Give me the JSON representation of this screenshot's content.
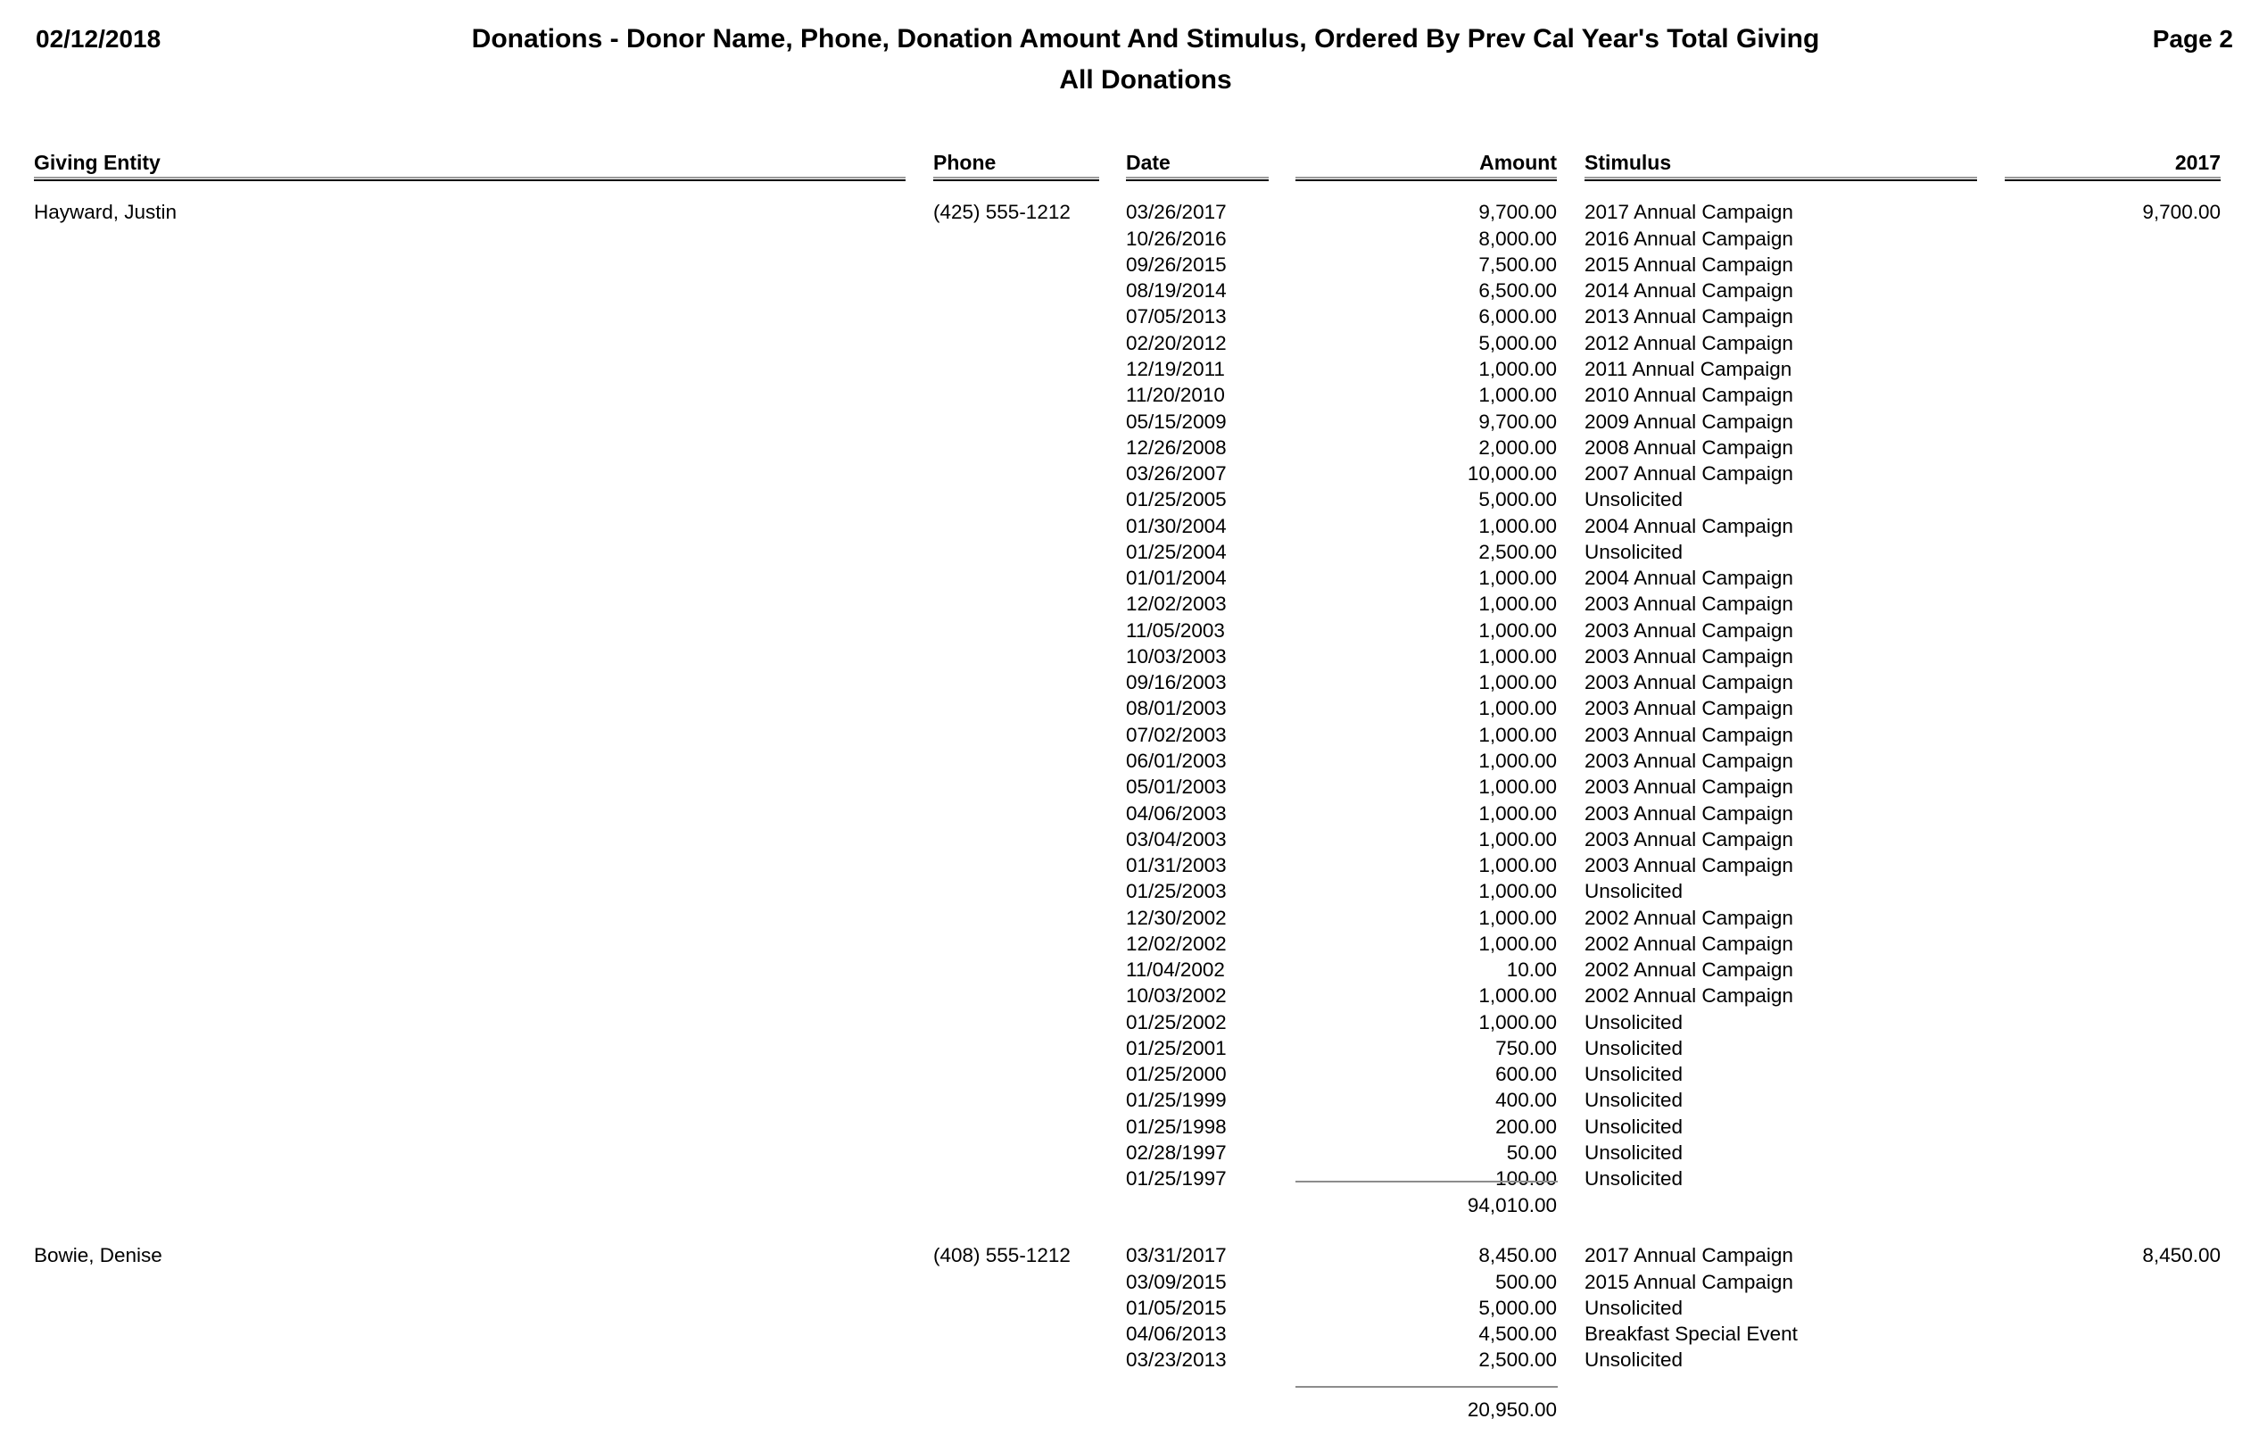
{
  "header": {
    "date": "02/12/2018",
    "title": "Donations - Donor Name, Phone, Donation Amount And Stimulus, Ordered By Prev Cal Year's Total Giving",
    "subtitle": "All Donations",
    "page": "Page 2"
  },
  "columns": {
    "entity": "Giving Entity",
    "phone": "Phone",
    "date": "Date",
    "amount": "Amount",
    "stimulus": "Stimulus",
    "year": "2017"
  },
  "donors": [
    {
      "name": "Hayward, Justin",
      "phone": "(425) 555-1212",
      "year_total": "9,700.00",
      "total": "94,010.00",
      "donations": [
        {
          "date": "03/26/2017",
          "amount": "9,700.00",
          "stimulus": "2017 Annual Campaign"
        },
        {
          "date": "10/26/2016",
          "amount": "8,000.00",
          "stimulus": "2016 Annual Campaign"
        },
        {
          "date": "09/26/2015",
          "amount": "7,500.00",
          "stimulus": "2015 Annual Campaign"
        },
        {
          "date": "08/19/2014",
          "amount": "6,500.00",
          "stimulus": "2014 Annual Campaign"
        },
        {
          "date": "07/05/2013",
          "amount": "6,000.00",
          "stimulus": "2013 Annual Campaign"
        },
        {
          "date": "02/20/2012",
          "amount": "5,000.00",
          "stimulus": "2012 Annual Campaign"
        },
        {
          "date": "12/19/2011",
          "amount": "1,000.00",
          "stimulus": "2011 Annual Campaign"
        },
        {
          "date": "11/20/2010",
          "amount": "1,000.00",
          "stimulus": "2010 Annual Campaign"
        },
        {
          "date": "05/15/2009",
          "amount": "9,700.00",
          "stimulus": "2009 Annual Campaign"
        },
        {
          "date": "12/26/2008",
          "amount": "2,000.00",
          "stimulus": "2008 Annual Campaign"
        },
        {
          "date": "03/26/2007",
          "amount": "10,000.00",
          "stimulus": "2007 Annual Campaign"
        },
        {
          "date": "01/25/2005",
          "amount": "5,000.00",
          "stimulus": "Unsolicited"
        },
        {
          "date": "01/30/2004",
          "amount": "1,000.00",
          "stimulus": "2004 Annual Campaign"
        },
        {
          "date": "01/25/2004",
          "amount": "2,500.00",
          "stimulus": "Unsolicited"
        },
        {
          "date": "01/01/2004",
          "amount": "1,000.00",
          "stimulus": "2004 Annual Campaign"
        },
        {
          "date": "12/02/2003",
          "amount": "1,000.00",
          "stimulus": "2003 Annual Campaign"
        },
        {
          "date": "11/05/2003",
          "amount": "1,000.00",
          "stimulus": "2003 Annual Campaign"
        },
        {
          "date": "10/03/2003",
          "amount": "1,000.00",
          "stimulus": "2003 Annual Campaign"
        },
        {
          "date": "09/16/2003",
          "amount": "1,000.00",
          "stimulus": "2003 Annual Campaign"
        },
        {
          "date": "08/01/2003",
          "amount": "1,000.00",
          "stimulus": "2003 Annual Campaign"
        },
        {
          "date": "07/02/2003",
          "amount": "1,000.00",
          "stimulus": "2003 Annual Campaign"
        },
        {
          "date": "06/01/2003",
          "amount": "1,000.00",
          "stimulus": "2003 Annual Campaign"
        },
        {
          "date": "05/01/2003",
          "amount": "1,000.00",
          "stimulus": "2003 Annual Campaign"
        },
        {
          "date": "04/06/2003",
          "amount": "1,000.00",
          "stimulus": "2003 Annual Campaign"
        },
        {
          "date": "03/04/2003",
          "amount": "1,000.00",
          "stimulus": "2003 Annual Campaign"
        },
        {
          "date": "01/31/2003",
          "amount": "1,000.00",
          "stimulus": "2003 Annual Campaign"
        },
        {
          "date": "01/25/2003",
          "amount": "1,000.00",
          "stimulus": "Unsolicited"
        },
        {
          "date": "12/30/2002",
          "amount": "1,000.00",
          "stimulus": "2002 Annual Campaign"
        },
        {
          "date": "12/02/2002",
          "amount": "1,000.00",
          "stimulus": "2002 Annual Campaign"
        },
        {
          "date": "11/04/2002",
          "amount": "10.00",
          "stimulus": "2002 Annual Campaign"
        },
        {
          "date": "10/03/2002",
          "amount": "1,000.00",
          "stimulus": "2002 Annual Campaign"
        },
        {
          "date": "01/25/2002",
          "amount": "1,000.00",
          "stimulus": "Unsolicited"
        },
        {
          "date": "01/25/2001",
          "amount": "750.00",
          "stimulus": "Unsolicited"
        },
        {
          "date": "01/25/2000",
          "amount": "600.00",
          "stimulus": "Unsolicited"
        },
        {
          "date": "01/25/1999",
          "amount": "400.00",
          "stimulus": "Unsolicited"
        },
        {
          "date": "01/25/1998",
          "amount": "200.00",
          "stimulus": "Unsolicited"
        },
        {
          "date": "02/28/1997",
          "amount": "50.00",
          "stimulus": "Unsolicited"
        },
        {
          "date": "01/25/1997",
          "amount": "100.00",
          "stimulus": "Unsolicited"
        }
      ]
    },
    {
      "name": "Bowie, Denise",
      "phone": "(408) 555-1212",
      "year_total": "8,450.00",
      "total": "20,950.00",
      "donations": [
        {
          "date": "03/31/2017",
          "amount": "8,450.00",
          "stimulus": "2017 Annual Campaign"
        },
        {
          "date": "03/09/2015",
          "amount": "500.00",
          "stimulus": "2015 Annual Campaign"
        },
        {
          "date": "01/05/2015",
          "amount": "5,000.00",
          "stimulus": "Unsolicited"
        },
        {
          "date": "04/06/2013",
          "amount": "4,500.00",
          "stimulus": "Breakfast Special Event"
        },
        {
          "date": "03/23/2013",
          "amount": "2,500.00",
          "stimulus": "Unsolicited"
        }
      ]
    }
  ]
}
